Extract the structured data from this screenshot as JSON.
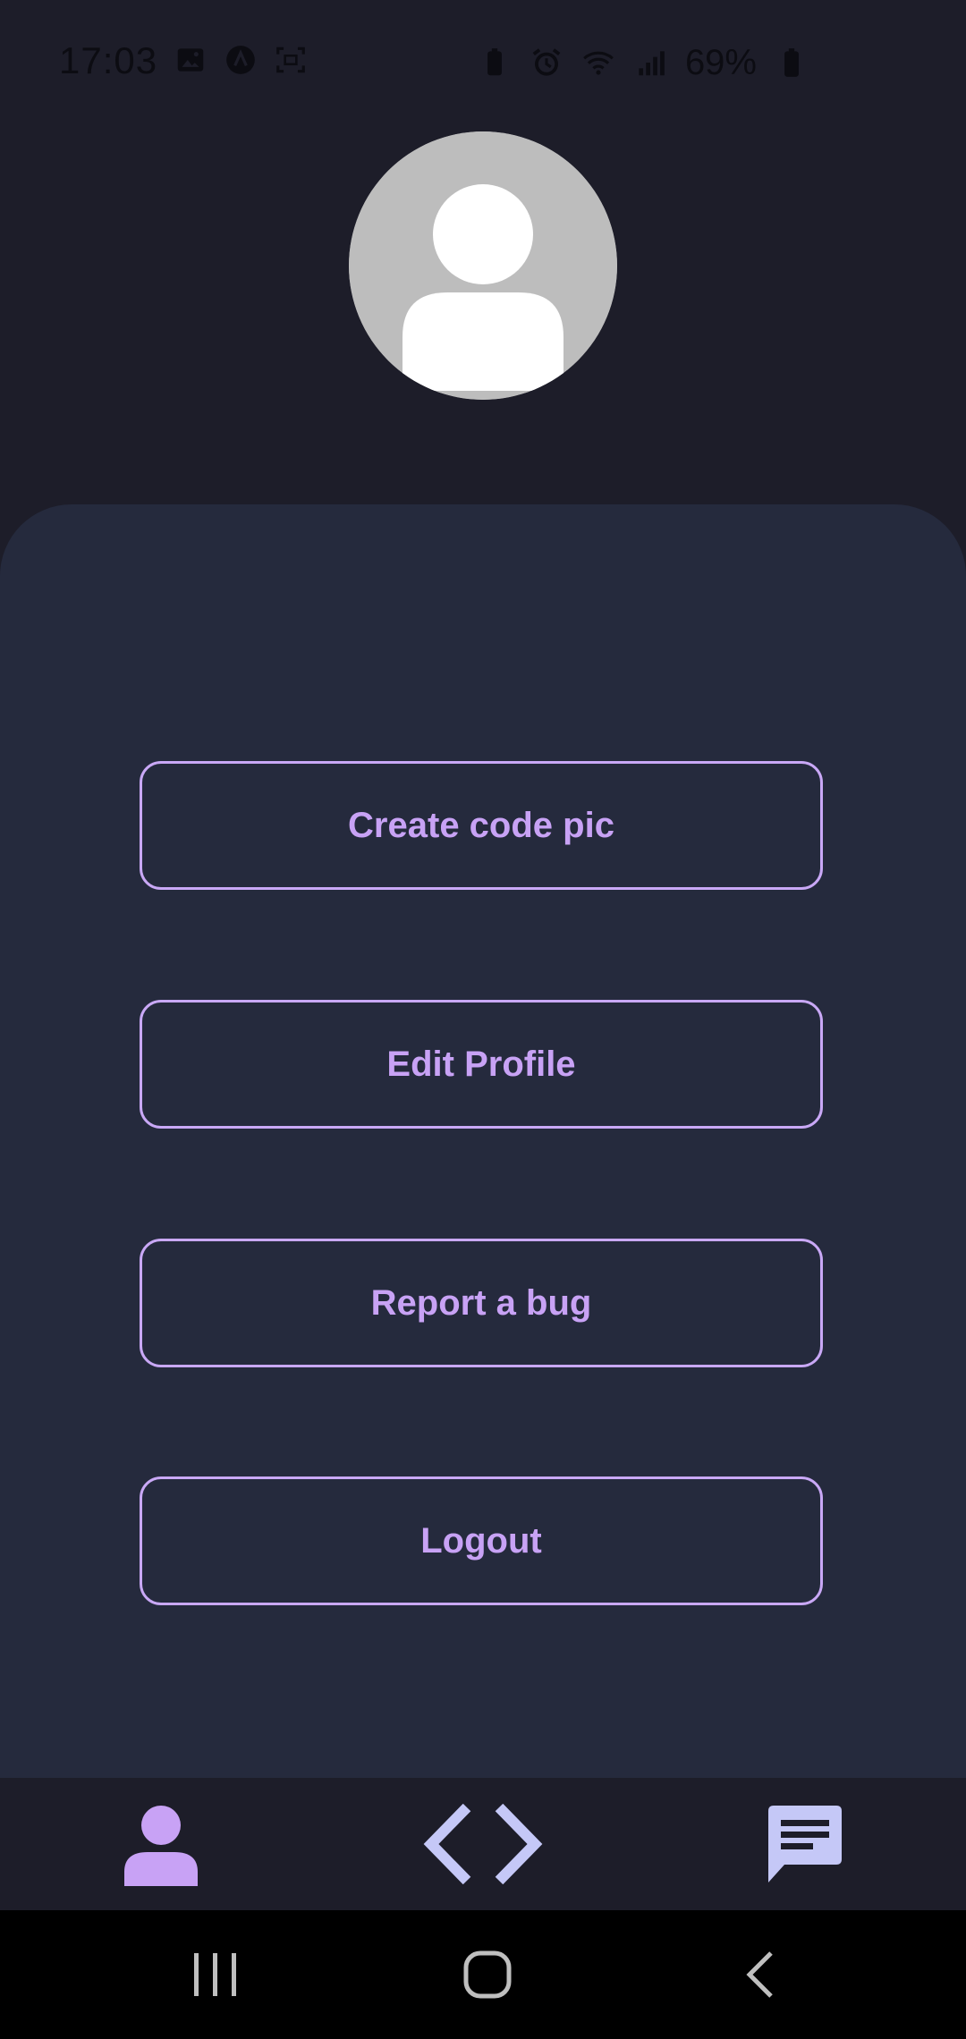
{
  "status_bar": {
    "time": "17:03",
    "battery": "69%",
    "left_icons": [
      "image-icon",
      "app-icon",
      "screenshot-icon"
    ],
    "right_icons": [
      "battery-saver-icon",
      "alarm-icon",
      "wifi-icon",
      "signal-icon",
      "battery-icon"
    ]
  },
  "profile": {
    "avatar_icon": "user-placeholder-icon"
  },
  "menu": {
    "items": [
      {
        "label": "Create code pic"
      },
      {
        "label": "Edit Profile"
      },
      {
        "label": "Report a bug"
      },
      {
        "label": "Logout"
      }
    ]
  },
  "bottom_nav": {
    "items": [
      {
        "icon": "person-icon",
        "active": true
      },
      {
        "icon": "code-icon",
        "active": false
      },
      {
        "icon": "chat-icon",
        "active": false
      }
    ]
  },
  "system_nav": {
    "items": [
      "recent-apps-icon",
      "home-icon",
      "back-icon"
    ]
  },
  "colors": {
    "background": "#1d1d29",
    "panel": "#252a3d",
    "accent": "#c8a2f5",
    "nav_inactive": "#c5c8f7"
  }
}
